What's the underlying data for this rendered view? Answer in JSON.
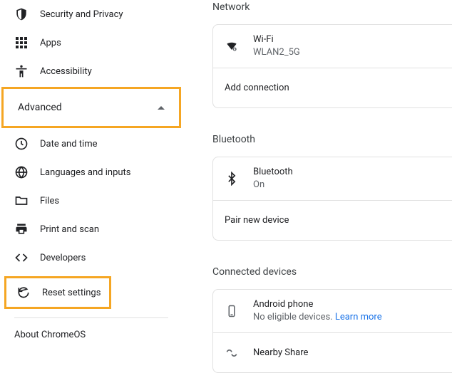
{
  "sidebar": {
    "items": [
      {
        "label": "Security and Privacy"
      },
      {
        "label": "Apps"
      },
      {
        "label": "Accessibility"
      }
    ],
    "advanced_label": "Advanced",
    "advanced_items": [
      {
        "label": "Date and time"
      },
      {
        "label": "Languages and inputs"
      },
      {
        "label": "Files"
      },
      {
        "label": "Print and scan"
      },
      {
        "label": "Developers"
      },
      {
        "label": "Reset settings"
      }
    ],
    "about_label": "About ChromeOS"
  },
  "main": {
    "network": {
      "title": "Network",
      "wifi": {
        "title": "Wi-Fi",
        "status": "WLAN2_5G"
      },
      "add": "Add connection"
    },
    "bluetooth": {
      "title": "Bluetooth",
      "bt": {
        "title": "Bluetooth",
        "status": "On"
      },
      "pair": "Pair new device"
    },
    "connected": {
      "title": "Connected devices",
      "phone": {
        "title": "Android phone",
        "status": "No eligible devices. ",
        "learn": "Learn more"
      },
      "nearby": {
        "title": "Nearby Share"
      }
    }
  }
}
